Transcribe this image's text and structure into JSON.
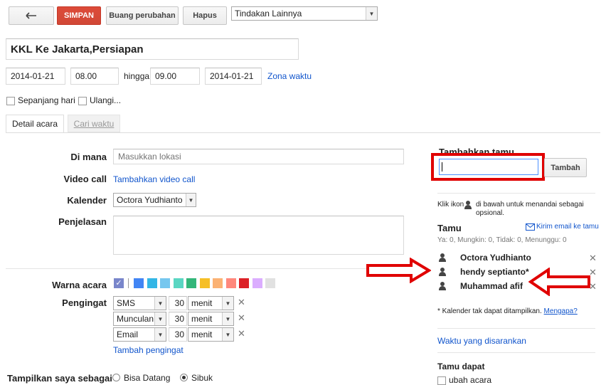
{
  "toolbar": {
    "back_icon": "arrow-left-icon",
    "save_label": "SIMPAN",
    "discard_label": "Buang perubahan",
    "delete_label": "Hapus",
    "more_actions": "Tindakan Lainnya"
  },
  "event": {
    "title": "KKL Ke Jakarta,Persiapan",
    "start_date": "2014-01-21",
    "start_time": "08.00",
    "until_label": "hingga",
    "end_time": "09.00",
    "end_date": "2014-01-21",
    "timezone_link": "Zona waktu",
    "all_day_label": "Sepanjang hari",
    "repeat_label": "Ulangi..."
  },
  "tabs": {
    "details": "Detail acara",
    "find_time": "Cari waktu"
  },
  "details": {
    "where_label": "Di mana",
    "where_placeholder": "Masukkan lokasi",
    "video_label": "Video call",
    "video_link": "Tambahkan video call",
    "calendar_label": "Kalender",
    "calendar_value": "Octora Yudhianto",
    "description_label": "Penjelasan",
    "color_label": "Warna acara",
    "colors": [
      "#7986cb",
      "#4285f4",
      "#33b6e6",
      "#76c7ef",
      "#5ad6c2",
      "#33b679",
      "#f6bf26",
      "#fbb274",
      "#ff887c",
      "#dc2127",
      "#dbadff",
      "#e1e1e1"
    ],
    "reminder_label": "Pengingat",
    "reminders": [
      {
        "type": "SMS",
        "value": "30",
        "unit": "menit"
      },
      {
        "type": "Munculan",
        "value": "30",
        "unit": "menit"
      },
      {
        "type": "Email",
        "value": "30",
        "unit": "menit"
      }
    ],
    "add_reminder": "Tambah pengingat",
    "show_as_label": "Tampilkan saya sebagai",
    "show_available": "Bisa Datang",
    "show_busy": "Sibuk"
  },
  "guests": {
    "add_title": "Tambahkan tamu",
    "add_button": "Tambah",
    "hint_before": "Klik ikon",
    "hint_after": "di bawah untuk menandai sebagai opsional.",
    "title": "Tamu",
    "email_link": "Kirim email ke tamu",
    "counts": "Ya: 0, Mungkin: 0, Tidak: 0, Menunggu: 0",
    "list": [
      "Octora Yudhianto",
      "hendy septianto*",
      "Muhammad afif"
    ],
    "calendar_note": "* Kalender tak dapat ditampilkan.",
    "why_link": "Mengapa?",
    "suggested_times": "Waktu yang disarankan",
    "guests_can_title": "Tamu dapat",
    "modify_event": "ubah acara"
  },
  "annotation_color": "#e00000"
}
